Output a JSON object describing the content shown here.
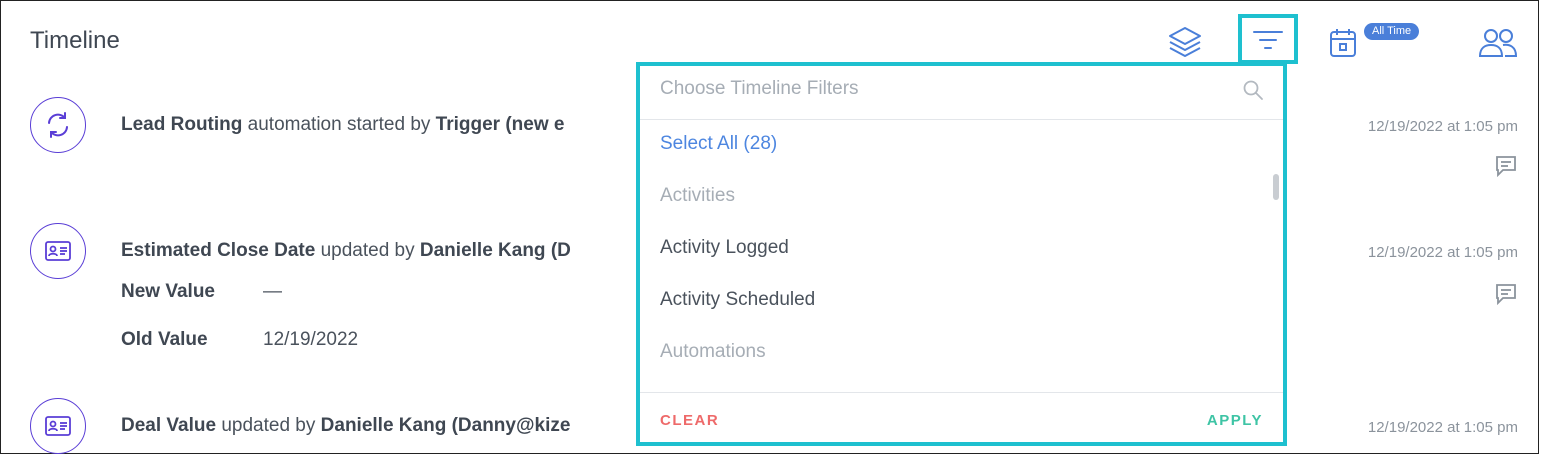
{
  "header": {
    "title": "Timeline",
    "badge": "All Time"
  },
  "rows": [
    {
      "bold1": "Lead Routing",
      "text1": " automation started by ",
      "bold2": "Trigger (new e",
      "date": "12/19/2022 at 1:05 pm"
    },
    {
      "bold1": "Estimated Close Date",
      "text1": " updated by ",
      "bold2": "Danielle Kang (D",
      "date": "12/19/2022 at 1:05 pm",
      "new_label": "New Value",
      "new_value": "—",
      "old_label": "Old Value",
      "old_value": "12/19/2022"
    },
    {
      "bold1": "Deal Value",
      "text1": " updated by ",
      "bold2": "Danielle Kang (Danny@kize",
      "date": "12/19/2022 at 1:05 pm"
    }
  ],
  "filter": {
    "placeholder": "Choose Timeline Filters",
    "select_all": "Select All (28)",
    "options": [
      "Activities",
      "Activity Logged",
      "Activity Scheduled",
      "Automations"
    ],
    "clear": "CLEAR",
    "apply": "APPLY"
  },
  "colors": {
    "accent_blue": "#4d86e0",
    "highlight": "#1ec0cf",
    "icon_purple": "#5a3ed6",
    "clear_red": "#ee6a6a",
    "apply_green": "#3ec4a5"
  },
  "icons": [
    "layers-icon",
    "filter-icon",
    "calendar-icon",
    "users-icon",
    "sync-icon",
    "id-card-icon",
    "comment-icon",
    "search-icon"
  ]
}
